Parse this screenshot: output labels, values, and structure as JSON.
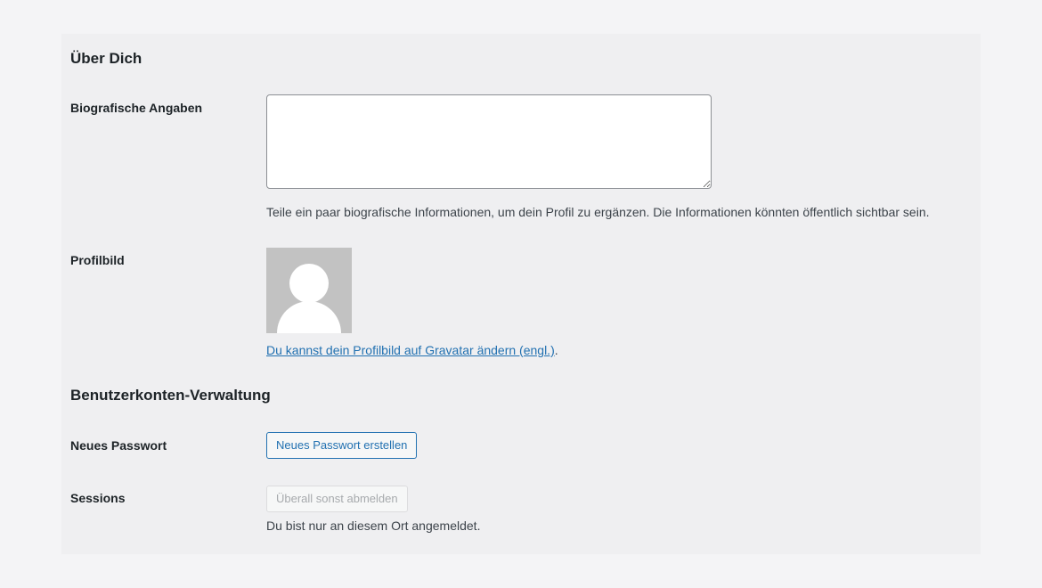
{
  "about": {
    "title": "Über Dich",
    "bio_label": "Biografische Angaben",
    "bio_value": "",
    "bio_description": "Teile ein paar biografische Informationen, um dein Profil zu ergänzen. Die Informationen könnten öffentlich sichtbar sein.",
    "avatar_label": "Profilbild",
    "avatar_icon": "default-avatar-person-icon",
    "gravatar_link": "Du kannst dein Profilbild auf Gravatar ändern (engl.)",
    "gravatar_suffix": "."
  },
  "account": {
    "title": "Benutzerkonten-Verwaltung",
    "password_label": "Neues Passwort",
    "password_button": "Neues Passwort erstellen",
    "sessions_label": "Sessions",
    "sessions_button": "Überall sonst abmelden",
    "sessions_description": "Du bist nur an diesem Ort angemeldet."
  },
  "colors": {
    "page_background": "#f4f4f6",
    "panel_background": "#efeff1",
    "link": "#2271b1",
    "avatar_background": "#c2c2c2"
  }
}
